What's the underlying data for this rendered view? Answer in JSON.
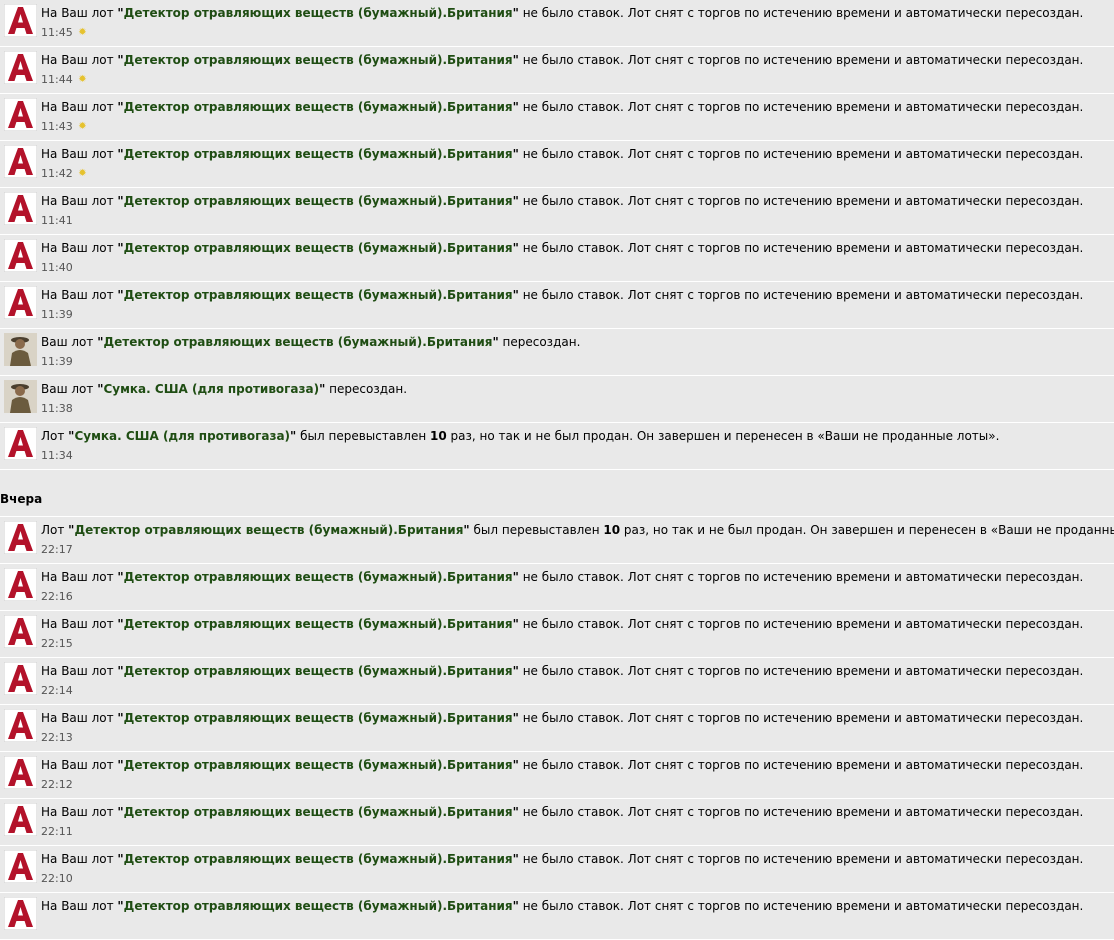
{
  "colors": {
    "background": "#e9e9e9",
    "lot_link": "#1f4d13",
    "avatar_logo": "#b3122a",
    "new_marker": "#e6c22e"
  },
  "icons": {
    "system": "auction-logo-icon",
    "user": "user-avatar",
    "new": "new-marker-icon"
  },
  "strings": {
    "no_bids_prefix": "На Ваш лот ",
    "no_bids_suffix": " не было ставок. Лот снят с торгов по истечению времени и автоматически пересоздан.",
    "recreated_prefix": "Ваш лот ",
    "recreated_suffix": " пересоздан.",
    "closed_prefix": "Лот ",
    "closed_mid": " был перевыставлен ",
    "closed_suffix": " раз, но так и не был продан. Он завершен и перенесен в «Ваши не проданные лоты»."
  },
  "today": [
    {
      "type": "no_bids",
      "lot": "Детектор отравляющих веществ (бумажный).Британия",
      "time": "11:45",
      "new": true
    },
    {
      "type": "no_bids",
      "lot": "Детектор отравляющих веществ (бумажный).Британия",
      "time": "11:44",
      "new": true
    },
    {
      "type": "no_bids",
      "lot": "Детектор отравляющих веществ (бумажный).Британия",
      "time": "11:43",
      "new": true
    },
    {
      "type": "no_bids",
      "lot": "Детектор отравляющих веществ (бумажный).Британия",
      "time": "11:42",
      "new": true
    },
    {
      "type": "no_bids",
      "lot": "Детектор отравляющих веществ (бумажный).Британия",
      "time": "11:41",
      "new": false
    },
    {
      "type": "no_bids",
      "lot": "Детектор отравляющих веществ (бумажный).Британия",
      "time": "11:40",
      "new": false
    },
    {
      "type": "no_bids",
      "lot": "Детектор отравляющих веществ (бумажный).Британия",
      "time": "11:39",
      "new": false
    },
    {
      "type": "recreated",
      "lot": "Детектор отравляющих веществ (бумажный).Британия",
      "time": "11:39",
      "new": false
    },
    {
      "type": "recreated",
      "lot": "Сумка. США (для противогаза)",
      "time": "11:38",
      "new": false
    },
    {
      "type": "closed",
      "lot": "Сумка. США (для противогаза)",
      "count": "10",
      "time": "11:34",
      "new": false
    }
  ],
  "yesterday_label": "Вчера",
  "yesterday": [
    {
      "type": "closed",
      "lot": "Детектор отравляющих веществ (бумажный).Британия",
      "count": "10",
      "time": "22:17",
      "new": false
    },
    {
      "type": "no_bids",
      "lot": "Детектор отравляющих веществ (бумажный).Британия",
      "time": "22:16",
      "new": false
    },
    {
      "type": "no_bids",
      "lot": "Детектор отравляющих веществ (бумажный).Британия",
      "time": "22:15",
      "new": false
    },
    {
      "type": "no_bids",
      "lot": "Детектор отравляющих веществ (бумажный).Британия",
      "time": "22:14",
      "new": false
    },
    {
      "type": "no_bids",
      "lot": "Детектор отравляющих веществ (бумажный).Британия",
      "time": "22:13",
      "new": false
    },
    {
      "type": "no_bids",
      "lot": "Детектор отравляющих веществ (бумажный).Британия",
      "time": "22:12",
      "new": false
    },
    {
      "type": "no_bids",
      "lot": "Детектор отравляющих веществ (бумажный).Британия",
      "time": "22:11",
      "new": false
    },
    {
      "type": "no_bids",
      "lot": "Детектор отравляющих веществ (бумажный).Британия",
      "time": "22:10",
      "new": false
    },
    {
      "type": "no_bids",
      "lot": "Детектор отравляющих веществ (бумажный).Британия",
      "time": "",
      "new": false
    }
  ]
}
